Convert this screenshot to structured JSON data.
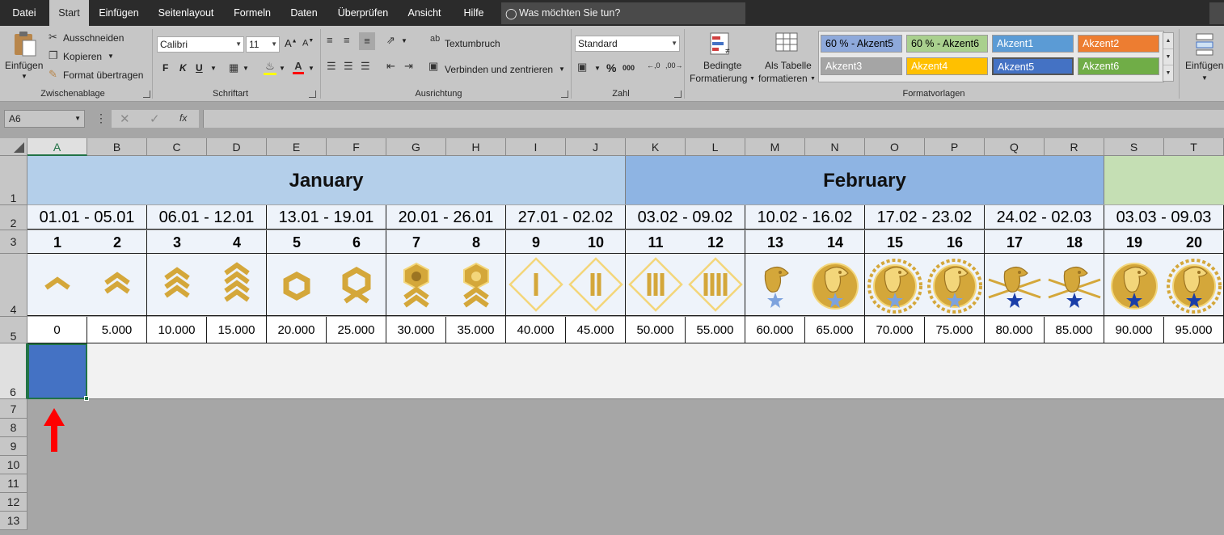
{
  "menu": {
    "tabs": [
      "Datei",
      "Start",
      "Einfügen",
      "Seitenlayout",
      "Formeln",
      "Daten",
      "Überprüfen",
      "Ansicht",
      "Hilfe"
    ],
    "active": "Start",
    "tell_me": "Was möchten Sie tun?"
  },
  "ribbon": {
    "clipboard": {
      "paste": "Einfügen",
      "cut": "Ausschneiden",
      "copy": "Kopieren",
      "format_painter": "Format übertragen",
      "label": "Zwischenablage"
    },
    "font": {
      "name": "Calibri",
      "size": "11",
      "bold": "F",
      "italic": "K",
      "underline": "U",
      "label": "Schriftart"
    },
    "alignment": {
      "wrap": "Textumbruch",
      "merge": "Verbinden und zentrieren",
      "label": "Ausrichtung"
    },
    "number": {
      "format": "Standard",
      "label": "Zahl"
    },
    "styles": {
      "conditional": [
        "Bedingte",
        "Formatierung"
      ],
      "as_table": [
        "Als Tabelle",
        "formatieren"
      ],
      "label": "Formatvorlagen",
      "cells": [
        {
          "name": "60 % - Akzent5",
          "bg": "#8ea9db",
          "fg": "#000000"
        },
        {
          "name": "60 % - Akzent6",
          "bg": "#a9d08e",
          "fg": "#000000"
        },
        {
          "name": "Akzent1",
          "bg": "#5b9bd5",
          "fg": "#ffffff"
        },
        {
          "name": "Akzent2",
          "bg": "#ed7d31",
          "fg": "#ffffff"
        },
        {
          "name": "Akzent3",
          "bg": "#a5a5a5",
          "fg": "#ffffff"
        },
        {
          "name": "Akzent4",
          "bg": "#ffc000",
          "fg": "#ffffff"
        },
        {
          "name": "Akzent5",
          "bg": "#4472c4",
          "fg": "#ffffff"
        },
        {
          "name": "Akzent6",
          "bg": "#70ad47",
          "fg": "#ffffff"
        }
      ]
    },
    "cells": {
      "insert": "Einfügen"
    }
  },
  "formula_bar": {
    "name_box": "A6",
    "fx": "fx",
    "value": ""
  },
  "columns": [
    "A",
    "B",
    "C",
    "D",
    "E",
    "F",
    "G",
    "H",
    "I",
    "J",
    "K",
    "L",
    "M",
    "N",
    "O",
    "P",
    "Q",
    "R",
    "S",
    "T"
  ],
  "rows": [
    "1",
    "2",
    "3",
    "4",
    "5",
    "6",
    "7",
    "8",
    "9",
    "10",
    "11",
    "12",
    "13"
  ],
  "months": [
    {
      "label": "January",
      "bg": "#b4cfea"
    },
    {
      "label": "February",
      "bg": "#8eb4e3"
    },
    {
      "label": "",
      "bg": "#c5dfb4"
    }
  ],
  "date_ranges": [
    "01.01 - 05.01",
    "06.01 - 12.01",
    "13.01 - 19.01",
    "20.01 - 26.01",
    "27.01 - 02.02",
    "03.02 - 09.02",
    "10.02 - 16.02",
    "17.02 - 23.02",
    "24.02 - 02.03",
    "03.03 - 09.03"
  ],
  "ranks": [
    "1",
    "2",
    "3",
    "4",
    "5",
    "6",
    "7",
    "8",
    "9",
    "10",
    "11",
    "12",
    "13",
    "14",
    "15",
    "16",
    "17",
    "18",
    "19",
    "20"
  ],
  "rank_icons": [
    "chevron-1-icon",
    "chevron-2-icon",
    "chevron-3-icon",
    "chevron-4-icon",
    "circle-icon",
    "shield-icon",
    "star-shield-icon",
    "star-circle-shield-icon",
    "diamond-bar-1-icon",
    "diamond-bar-2-icon",
    "diamond-bar-3-icon",
    "diamond-bar-4-icon",
    "eagle-icon",
    "eagle-circle-icon",
    "eagle-wreath-icon",
    "eagle-laurel-icon",
    "eagle-arrows-icon",
    "eagle-star-arrows-icon",
    "eagle-medal-icon",
    "eagle-laurel-medal-icon"
  ],
  "points": [
    "0",
    "5.000",
    "10.000",
    "15.000",
    "20.000",
    "25.000",
    "30.000",
    "35.000",
    "40.000",
    "45.000",
    "50.000",
    "55.000",
    "60.000",
    "65.000",
    "70.000",
    "75.000",
    "80.000",
    "85.000",
    "90.000",
    "95.000"
  ],
  "selection": {
    "cell": "A6",
    "fill": "#4472c4"
  }
}
